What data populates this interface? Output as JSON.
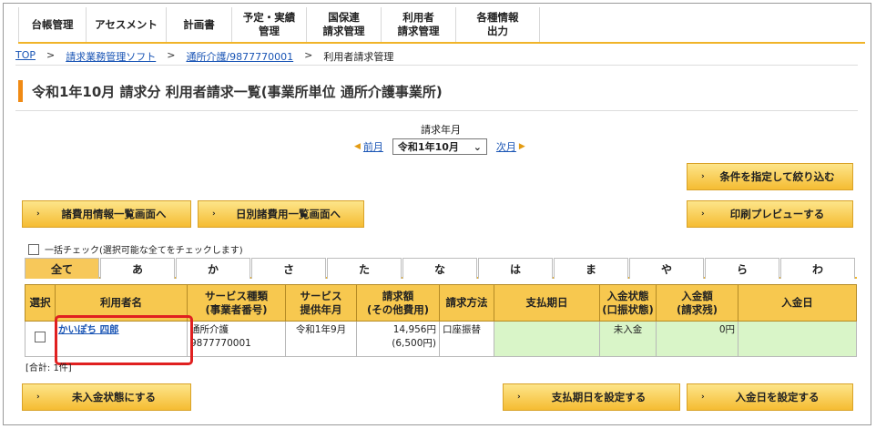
{
  "nav": {
    "tabs": [
      "台帳管理",
      "アセスメント",
      "計画書",
      "予定・実績\n管理",
      "国保連\n請求管理",
      "利用者\n請求管理",
      "各種情報\n出力"
    ]
  },
  "breadcrumb": [
    "TOP",
    "請求業務管理ソフト",
    "通所介護/9877770001",
    "利用者請求管理"
  ],
  "page_title": "令和1年10月 請求分  利用者請求一覧(事業所単位  通所介護事業所)",
  "period": {
    "label": "請求年月",
    "prev": "前月",
    "selected": "令和1年10月",
    "next": "次月"
  },
  "buttons": {
    "filter": "条件を指定して絞り込む",
    "misc_expenses": "諸費用情報一覧画面へ",
    "daily_expenses": "日別諸費用一覧画面へ",
    "print_preview": "印刷プレビューする",
    "unpaid_status": "未入金状態にする",
    "set_pay_date": "支払期日を設定する",
    "set_deposit_date": "入金日を設定する"
  },
  "check_all_label": "一括チェック(選択可能な全てをチェックします)",
  "kana_tabs": [
    "全て",
    "あ",
    "か",
    "さ",
    "た",
    "な",
    "は",
    "ま",
    "や",
    "ら",
    "わ"
  ],
  "table": {
    "headers": [
      "選択",
      "利用者名",
      "サービス種類\n(事業者番号)",
      "サービス\n提供年月",
      "請求額\n(その他費用)",
      "請求方法",
      "支払期日",
      "入金状態\n(口振状態)",
      "入金額\n(請求残)",
      "入金日"
    ],
    "rows": [
      {
        "name": "かいぽち 四郎",
        "service": "通所介護",
        "provider": "9877770001",
        "month": "令和1年9月",
        "amount": "14,956円",
        "other": "(6,500円)",
        "method": "口座振替",
        "pay_date": "",
        "status": "未入金",
        "deposit": "0円",
        "deposit_date": ""
      }
    ]
  },
  "total": "[合計: 1件]",
  "colors": {
    "accent": "#f0b429",
    "button": "#f5bc32",
    "header": "#f7c84f",
    "highlight": "#e02020",
    "paid_cell": "#d9f5c8"
  }
}
